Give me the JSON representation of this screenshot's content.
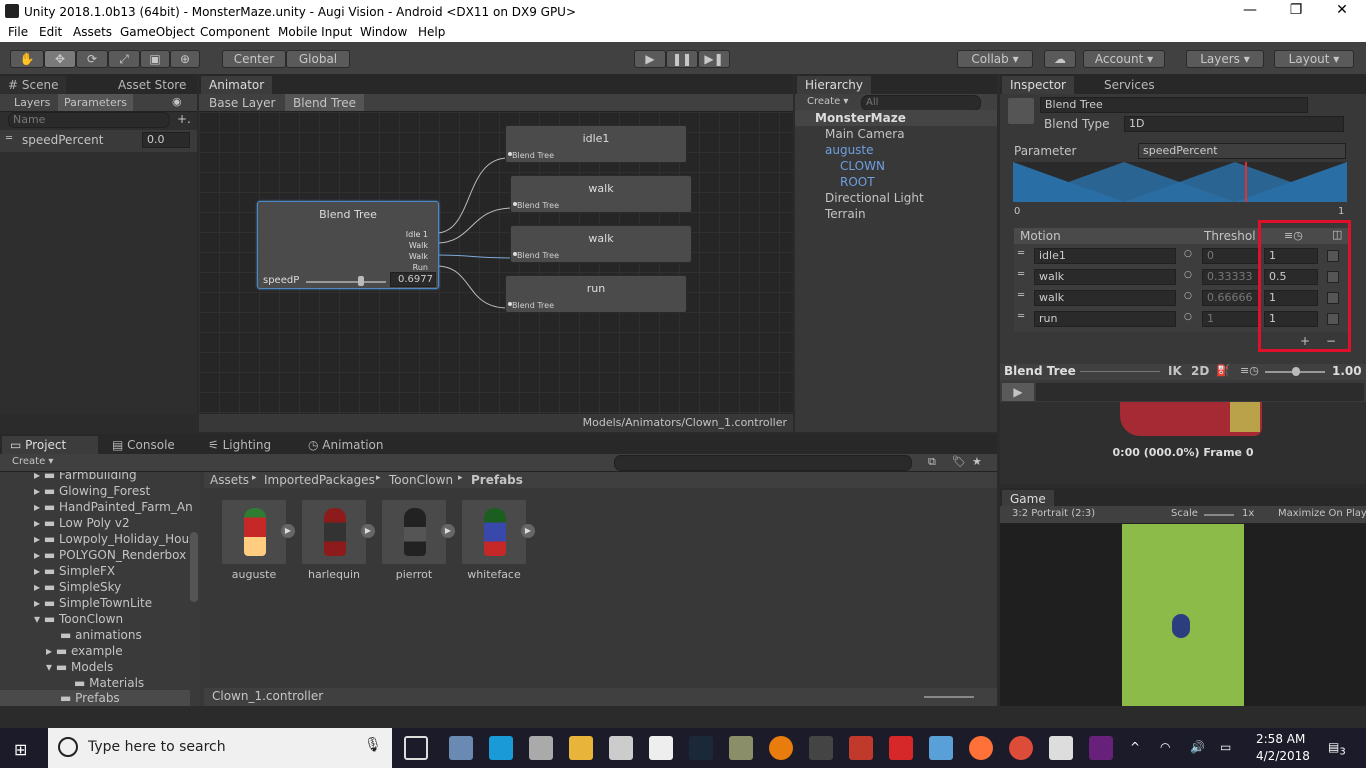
{
  "window": {
    "title": "Unity 2018.1.0b13 (64bit) - MonsterMaze.unity - Augi Vision - Android <DX11 on DX9 GPU>",
    "minimize": "—",
    "restore": "❐",
    "close": "✕"
  },
  "menu": [
    "File",
    "Edit",
    "Assets",
    "GameObject",
    "Component",
    "Mobile Input",
    "Window",
    "Help"
  ],
  "toolbar": {
    "center": "Center",
    "global": "Global",
    "collab": "Collab ▾",
    "account": "Account ▾",
    "layers": "Layers ▾",
    "layout": "Layout ▾"
  },
  "scene_tabs": {
    "scene": "# Scene",
    "asset_store": "Asset Store"
  },
  "params_panel": {
    "tab_layers": "Layers",
    "tab_parameters": "Parameters",
    "search_placeholder": "Name",
    "param_name": "speedPercent",
    "param_value": "0.0"
  },
  "animator": {
    "tab": "Animator",
    "breadcrumb_base": "Base Layer",
    "breadcrumb_tree": "Blend Tree",
    "blend_node_title": "Blend Tree",
    "blend_outputs": [
      "Idle 1",
      "Walk",
      "Walk",
      "Run"
    ],
    "blend_param_short": "speedP",
    "blend_param_value": "0.6977",
    "motion_nodes": [
      {
        "title": "idle1",
        "sub": "Blend Tree"
      },
      {
        "title": "walk",
        "sub": "Blend Tree"
      },
      {
        "title": "walk",
        "sub": "Blend Tree"
      },
      {
        "title": "run",
        "sub": "Blend Tree"
      }
    ],
    "footer_path": "Models/Animators/Clown_1.controller"
  },
  "hierarchy": {
    "tab": "Hierarchy",
    "create": "Create ▾",
    "search_placeholder": "All",
    "scene": "MonsterMaze",
    "items": [
      "Main Camera",
      "auguste",
      "CLOWN",
      "ROOT",
      "Directional Light",
      "Terrain"
    ]
  },
  "inspector": {
    "tab": "Inspector",
    "tab_services": "Services",
    "name_field": "Blend Tree",
    "blend_type_label": "Blend Type",
    "blend_type_value": "1D",
    "parameter_label": "Parameter",
    "parameter_value": "speedPercent",
    "graph_min": "0",
    "graph_max": "1",
    "motion_header": "Motion",
    "threshold_header": "Threshol",
    "rows": [
      {
        "motion": "idle1",
        "threshold": "0",
        "speed": "1"
      },
      {
        "motion": "walk",
        "threshold": "0.33333",
        "speed": "0.5"
      },
      {
        "motion": "walk",
        "threshold": "0.66666",
        "speed": "1"
      },
      {
        "motion": "run",
        "threshold": "1",
        "speed": "1"
      }
    ],
    "add": "+",
    "remove": "−"
  },
  "preview": {
    "title": "Blend Tree",
    "ik": "IK",
    "two_d": "2D",
    "speed": "1.00",
    "frame_text": "0:00 (000.0%) Frame 0"
  },
  "game": {
    "tab": "Game",
    "aspect": "3:2 Portrait (2:3)",
    "scale_label": "Scale",
    "scale_value": "1x",
    "maximize": "Maximize On Play"
  },
  "bottom_tabs": {
    "project": "Project",
    "console": "Console",
    "lighting": "Lighting",
    "animation": "Animation"
  },
  "project": {
    "create": "Create ▾",
    "breadcrumb": [
      "Assets",
      "ImportedPackages",
      "ToonClown",
      "Prefabs"
    ],
    "folders": [
      "Farmbuilding",
      "Glowing_Forest",
      "HandPainted_Farm_An",
      "Low Poly v2",
      "Lowpoly_Holiday_Hous",
      "POLYGON_Renderbox",
      "SimpleFX",
      "SimpleSky",
      "SimpleTownLite",
      "ToonClown",
      "animations",
      "example",
      "Models",
      "Materials",
      "Prefabs"
    ],
    "assets": [
      "auguste",
      "harlequin",
      "pierrot",
      "whiteface"
    ],
    "status": "Clown_1.controller"
  },
  "taskbar": {
    "search_placeholder": "Type here to search",
    "time": "2:58 AM",
    "date": "4/2/2018",
    "notifications": "3"
  }
}
